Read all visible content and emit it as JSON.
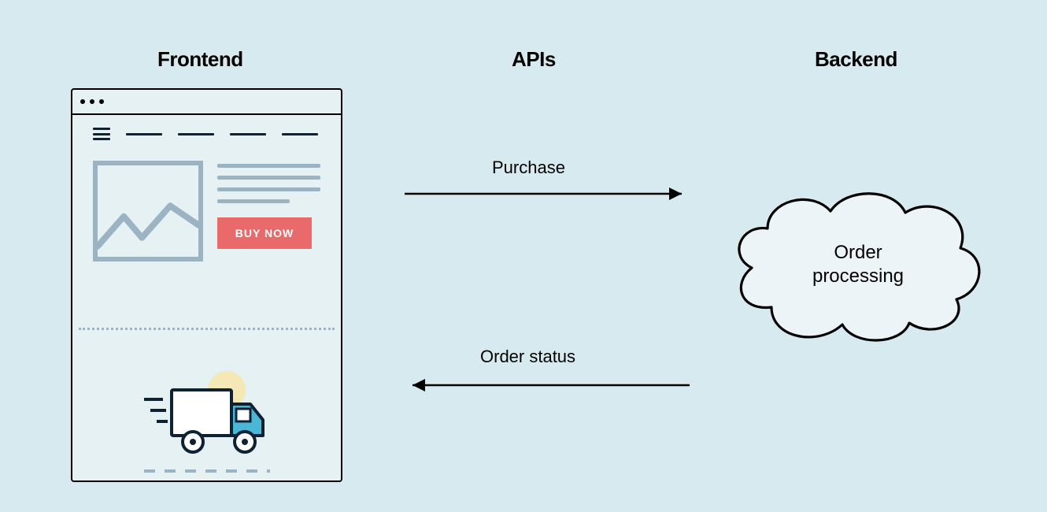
{
  "headers": {
    "frontend": "Frontend",
    "apis": "APIs",
    "backend": "Backend"
  },
  "frontend": {
    "buy_button": "BUY NOW"
  },
  "api": {
    "purchase_label": "Purchase",
    "status_label": "Order status"
  },
  "backend": {
    "cloud_label_line1": "Order",
    "cloud_label_line2": "processing"
  },
  "colors": {
    "bg": "#d7eaef",
    "panel": "#e6f1f4",
    "wire": "#9ab4c4",
    "accent": "#e86a6a",
    "truck_blue": "#4bb7d6",
    "sun": "#f4e9b6"
  }
}
